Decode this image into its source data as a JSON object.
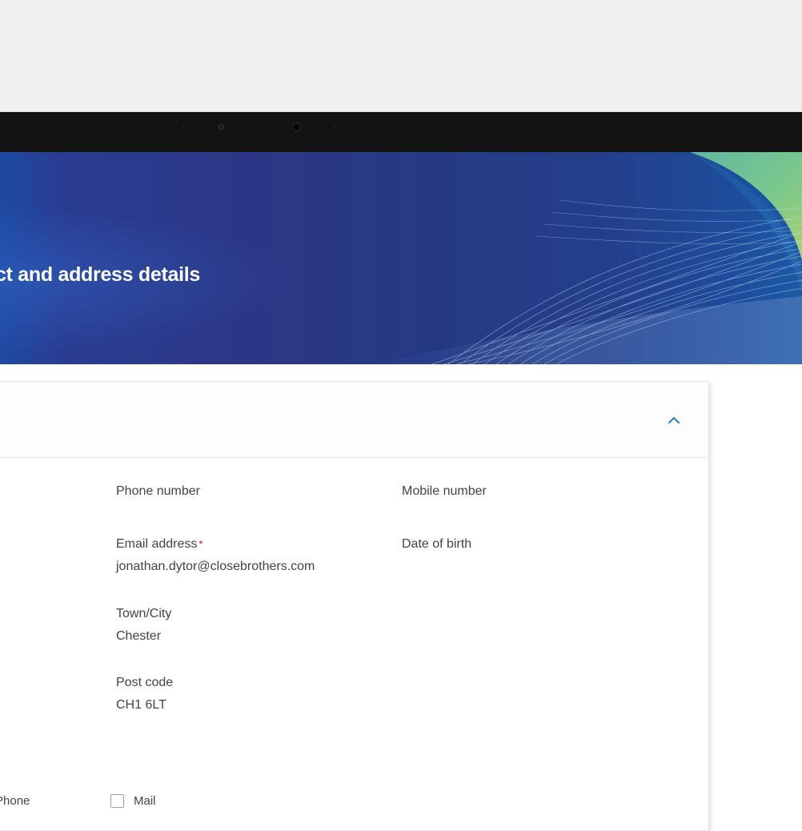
{
  "page": {
    "title": "ct and address details"
  },
  "details": {
    "phone_label": "Phone number",
    "mobile_label": "Mobile number",
    "email_label": "Email address",
    "email_required_mark": "*",
    "email_value": "jonathan.dytor@closebrothers.com",
    "dob_label": "Date of birth",
    "town_label": "Town/City",
    "town_value": "Chester",
    "postcode_label": "Post code",
    "postcode_value": "CH1 6LT"
  },
  "contact_preferences": {
    "phone_label": "Phone",
    "mail_label": "Mail",
    "mail_checked": false
  },
  "colors": {
    "hero_blue": "#2b3786",
    "accent_green": "#6fc29a",
    "chevron_blue": "#1f86c8",
    "required_red": "#c8102e"
  },
  "icons": {
    "collapse": "chevron-up-icon"
  }
}
